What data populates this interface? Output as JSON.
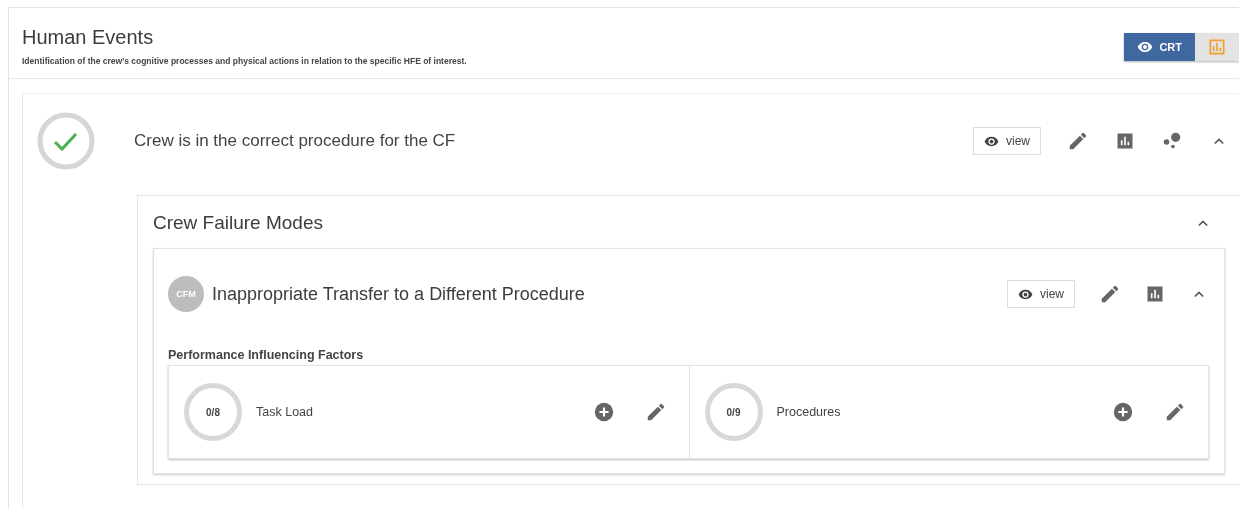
{
  "header": {
    "title": "Human Events",
    "subtitle": "Identification of the crew’s cognitive processes and physical actions in relation to the specific HFE of interest."
  },
  "view_toggle": [
    {
      "kind": "crt",
      "label": "CRT",
      "selected": true
    },
    {
      "kind": "chart",
      "selected": false
    }
  ],
  "human_event": {
    "title": "Crew is in the correct procedure for the CF",
    "completed": true,
    "expanded": true,
    "view_label": "view",
    "failure_modes": {
      "title": "Crew Failure Modes",
      "expanded": true,
      "items": [
        {
          "badge": "CFM",
          "title": "Inappropriate Transfer to a Different Procedure",
          "view_label": "view",
          "expanded": true,
          "pif_heading": "Performance Influencing Factors",
          "pifs": [
            {
              "count": "0/8",
              "name": "Task Load"
            },
            {
              "count": "0/9",
              "name": "Procedures"
            }
          ]
        }
      ]
    }
  }
}
